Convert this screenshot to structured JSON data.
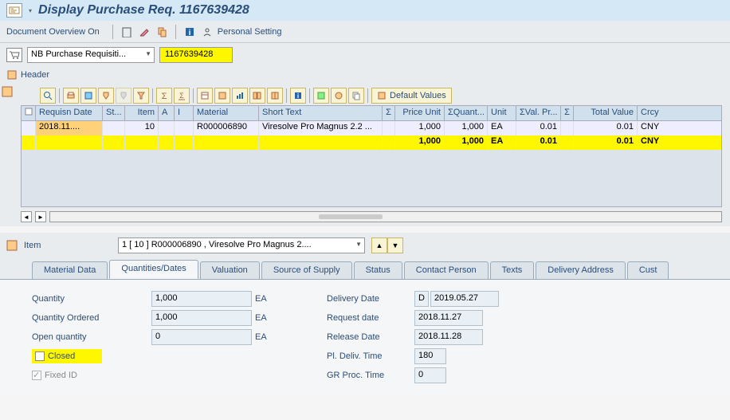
{
  "title": "Display Purchase Req. 1167639428",
  "toolbar": {
    "doc_overview": "Document Overview On",
    "personal_setting": "Personal Setting"
  },
  "doc": {
    "type": "NB Purchase Requisiti...",
    "number": "1167639428"
  },
  "header_label": "Header",
  "grid_toolbar": {
    "default_values": "Default Values"
  },
  "grid": {
    "headers": {
      "status_icon": "",
      "requisn_date": "Requisn Date",
      "st": "St...",
      "item": "Item",
      "a": "A",
      "i": "I",
      "material": "Material",
      "short_text": "Short Text",
      "sigma1": "Σ",
      "price_unit": "Price Unit",
      "sigma_quant": "ΣQuant...",
      "unit": "Unit",
      "sigma_val": "ΣVal. Pr...",
      "sigma2": "Σ",
      "total_value": "Total Value",
      "crcy": "Crcy"
    },
    "row": {
      "requisn_date": "2018.11....",
      "st": "",
      "item": "10",
      "a": "",
      "i": "",
      "material": "R000006890",
      "short_text": "Viresolve Pro Magnus 2.2 ...",
      "price_unit": "1,000",
      "quant": "1,000",
      "unit": "EA",
      "val_pr": "0.01",
      "total_value": "0.01",
      "crcy": "CNY"
    },
    "total": {
      "price_unit": "1,000",
      "quant": "1,000",
      "unit": "EA",
      "val_pr": "0.01",
      "total_value": "0.01",
      "crcy": "CNY"
    }
  },
  "item": {
    "label": "Item",
    "selected": "1 [ 10 ] R000006890 , Viresolve Pro Magnus 2...."
  },
  "tabs": {
    "material_data": "Material Data",
    "quantities_dates": "Quantities/Dates",
    "valuation": "Valuation",
    "source_of_supply": "Source of Supply",
    "status": "Status",
    "contact_person": "Contact Person",
    "texts": "Texts",
    "delivery_address": "Delivery Address",
    "cust": "Cust"
  },
  "form": {
    "quantity_label": "Quantity",
    "quantity": "1,000",
    "quantity_unit": "EA",
    "quantity_ordered_label": "Quantity Ordered",
    "quantity_ordered": "1,000",
    "quantity_ordered_unit": "EA",
    "open_quantity_label": "Open quantity",
    "open_quantity": "0",
    "open_quantity_unit": "EA",
    "closed_label": "Closed",
    "fixed_id_label": "Fixed ID",
    "delivery_date_label": "Delivery Date",
    "delivery_date_cat": "D",
    "delivery_date": "2019.05.27",
    "request_date_label": "Request date",
    "request_date": "2018.11.27",
    "release_date_label": "Release Date",
    "release_date": "2018.11.28",
    "pl_deliv_time_label": "Pl. Deliv. Time",
    "pl_deliv_time": "180",
    "gr_proc_time_label": "GR Proc. Time",
    "gr_proc_time": "0"
  }
}
